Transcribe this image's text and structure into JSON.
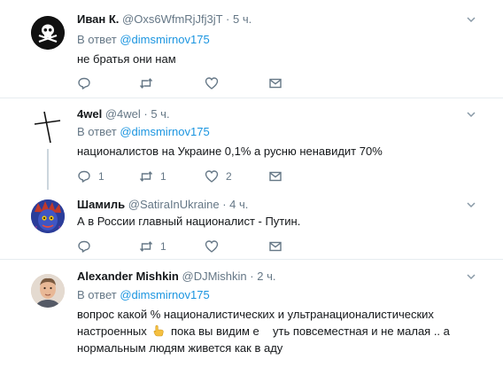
{
  "colors": {
    "link": "#1b95e0",
    "muted": "#657786",
    "text": "#14171a",
    "thread_line": "#ccd6dd",
    "separator": "#e6ecf0"
  },
  "tweets": [
    {
      "name": "Иван К.",
      "handle": "@Oxs6WfmRjJfj3jT",
      "dot": "·",
      "time": "5 ч.",
      "reply_prefix": "В ответ",
      "reply_mention": "@dimsmirnov175",
      "text": "не братья они нам",
      "avatar_icon": "skull-crossbones-icon",
      "counts": {
        "reply": "",
        "retweet": "",
        "like": ""
      }
    },
    {
      "name": "4wel",
      "handle": "@4wel",
      "dot": "·",
      "time": "5 ч.",
      "reply_prefix": "В ответ",
      "reply_mention": "@dimsmirnov175",
      "text": "националистов на Украине 0,1% а русню ненавидит 70%",
      "avatar_icon": "cross-icon",
      "counts": {
        "reply": "1",
        "retweet": "1",
        "like": "2"
      }
    },
    {
      "name": "Шамиль",
      "handle": "@SatiraInUkraine",
      "dot": "·",
      "time": "4 ч.",
      "text": "А в России главный националист - Путин.",
      "avatar_icon": "blue-face-icon",
      "counts": {
        "reply": "",
        "retweet": "1",
        "like": ""
      }
    },
    {
      "name": "Alexander Mishkin",
      "handle": "@DJMishkin",
      "dot": "·",
      "time": "2 ч.",
      "reply_prefix": "В ответ",
      "reply_mention": "@dimsmirnov175",
      "text_line1": "вопрос какой % националистических и ультранационалистических",
      "text_line2a": "настроенных",
      "text_line2b": "пока вы видим е",
      "text_line2c": "уть повсеместная  и не малая .. а",
      "text_line3": "нормальным людям живется как в аду",
      "avatar_icon": "man-photo-icon"
    }
  ]
}
